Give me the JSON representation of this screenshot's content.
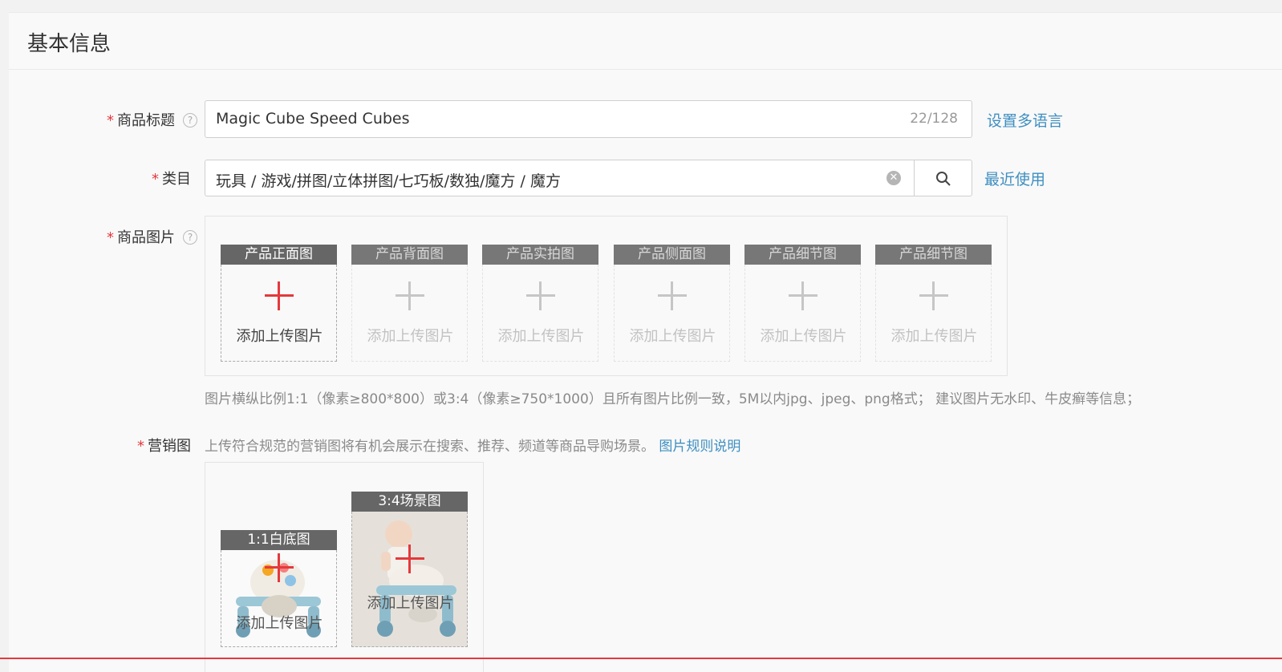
{
  "section": {
    "title": "基本信息"
  },
  "fields": {
    "product_title": {
      "label": "商品标题",
      "help": "?",
      "value": "Magic Cube Speed Cubes",
      "counter": "22/128",
      "link": "设置多语言"
    },
    "category": {
      "label": "类目",
      "value": "玩具 / 游戏/拼图/立体拼图/七巧板/数独/魔方 / 魔方",
      "link": "最近使用"
    },
    "product_images": {
      "label": "商品图片",
      "help": "?",
      "upload_text": "添加上传图片",
      "slots": [
        "产品正面图",
        "产品背面图",
        "产品实拍图",
        "产品侧面图",
        "产品细节图",
        "产品细节图"
      ],
      "hint": "图片横纵比例1:1（像素≥800*800）或3:4（像素≥750*1000）且所有图片比例一致，5M以内jpg、jpeg、png格式； 建议图片无水印、牛皮癣等信息；"
    },
    "marketing": {
      "label": "营销图",
      "desc": "上传符合规范的营销图将有机会展示在搜索、推荐、频道等商品导购场景。",
      "rules_link": "图片规则说明",
      "slots": [
        "1:1白底图",
        "3:4场景图"
      ],
      "upload_text": "添加上传图片"
    }
  },
  "colors": {
    "accent_red": "#e4393c",
    "link_blue": "#3f8fc1",
    "header_gray": "#666666"
  }
}
